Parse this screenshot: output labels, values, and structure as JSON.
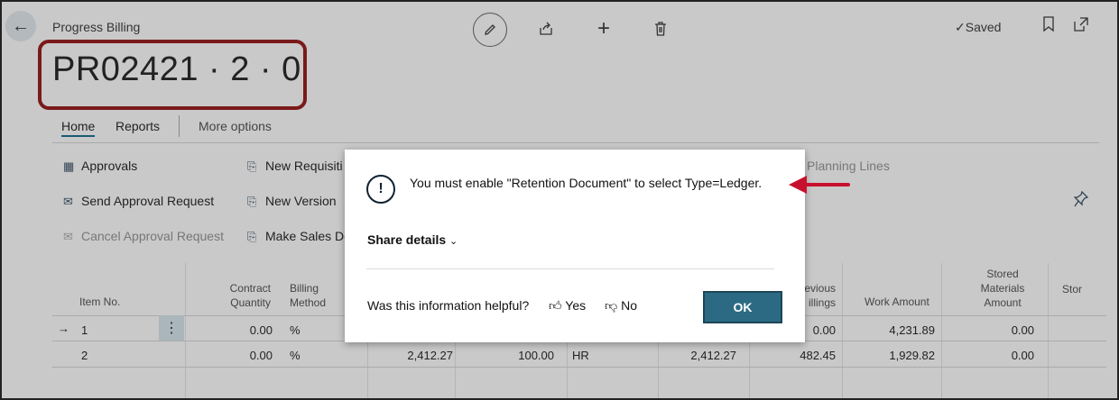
{
  "header": {
    "breadcrumb": "Progress Billing",
    "title": "PR02421 · 2 · 0",
    "saved_label": "Saved"
  },
  "tabs": [
    {
      "label": "Home"
    },
    {
      "label": "Reports"
    },
    {
      "label": "More options"
    }
  ],
  "actions": {
    "approvals": "Approvals",
    "send_approval_request": "Send Approval Request",
    "cancel_approval_request": "Cancel Approval Request",
    "new_requisition": "New Requisiti",
    "new_version": "New Version",
    "make_sales": "Make Sales Do",
    "planning_lines": "Planning Lines"
  },
  "grid": {
    "headers": {
      "item_no": "Item No.",
      "contract_quantity_1": "Contract",
      "contract_quantity_2": "Quantity",
      "billing_method_1": "Billing",
      "billing_method_2": "Method",
      "prev_billings_1": "evious",
      "prev_billings_2": "illings",
      "work_amount": "Work Amount",
      "stored_1": "Stored",
      "stored_2": "Materials",
      "stored_3": "Amount",
      "stor": "Stor"
    },
    "rows": [
      {
        "arrow": "→",
        "item_no": "1",
        "contract_qty": "0.00",
        "billing_method": "%",
        "c4": "",
        "c5": "",
        "c6": "",
        "c7": "",
        "prev_billings": "0.00",
        "work_amount": "4,231.89",
        "stored": "0.00"
      },
      {
        "arrow": "",
        "item_no": "2",
        "contract_qty": "0.00",
        "billing_method": "%",
        "c4": "2,412.27",
        "c5": "100.00",
        "c6": "HR",
        "c7": "2,412.27",
        "prev_billings": "482.45",
        "work_amount": "1,929.82",
        "stored": "0.00"
      }
    ]
  },
  "dialog": {
    "icon": "!",
    "message": "You must enable \"Retention Document\" to select Type=Ledger.",
    "share_details": "Share details",
    "helpful_question": "Was this information helpful?",
    "yes": "Yes",
    "no": "No",
    "ok": "OK"
  },
  "colors": {
    "annotation_red": "#c8102e",
    "ok_button": "#2b6a82"
  }
}
